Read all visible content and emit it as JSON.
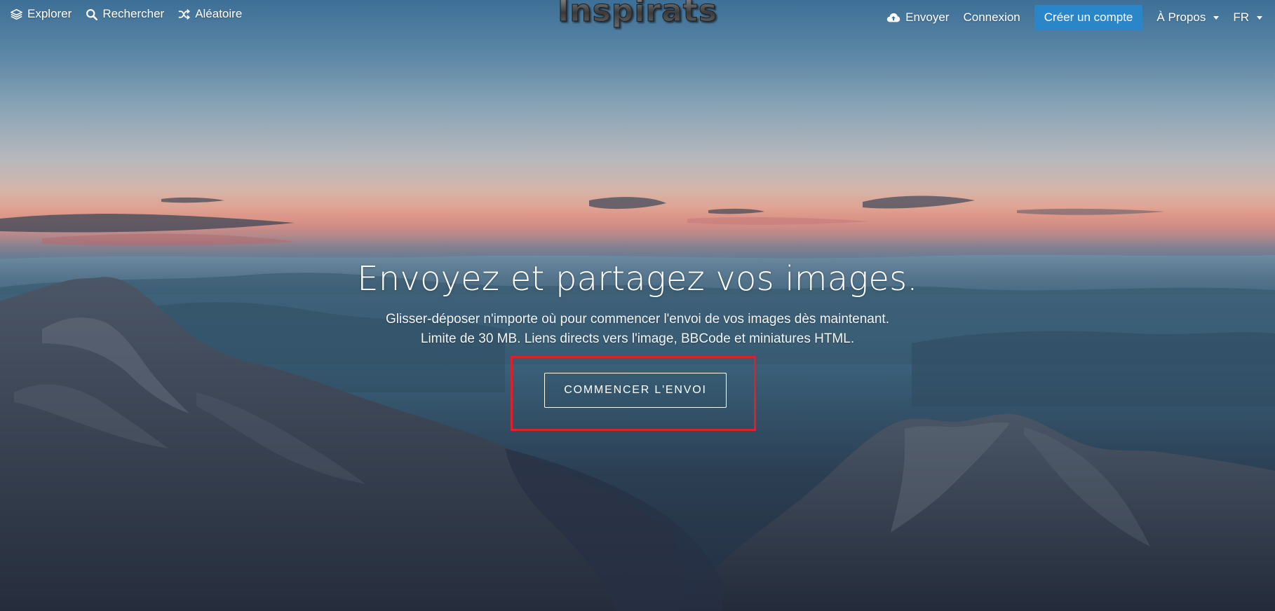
{
  "nav": {
    "left": [
      {
        "label": "Explorer",
        "icon": "layers-icon"
      },
      {
        "label": "Rechercher",
        "icon": "search-icon"
      },
      {
        "label": "Aléatoire",
        "icon": "shuffle-icon"
      }
    ],
    "right": {
      "upload_label": "Envoyer",
      "upload_icon": "cloud-upload-icon",
      "login_label": "Connexion",
      "create_account_label": "Créer un compte",
      "about_label": "À Propos",
      "language_label": "FR"
    }
  },
  "logo": {
    "text": "Inspirats"
  },
  "hero": {
    "headline": "Envoyez et partagez vos images.",
    "subtitle_line1": "Glisser-déposer n'importe où pour commencer l'envoi de vos images dès maintenant.",
    "subtitle_line2": "Limite de 30 MB. Liens directs vers l'image, BBCode et miniatures HTML.",
    "start_button_label": "COMMENCER L'ENVOI"
  },
  "colors": {
    "accent_button": "#2a86c9",
    "highlight_box": "#e01f26",
    "text": "#ffffff"
  }
}
